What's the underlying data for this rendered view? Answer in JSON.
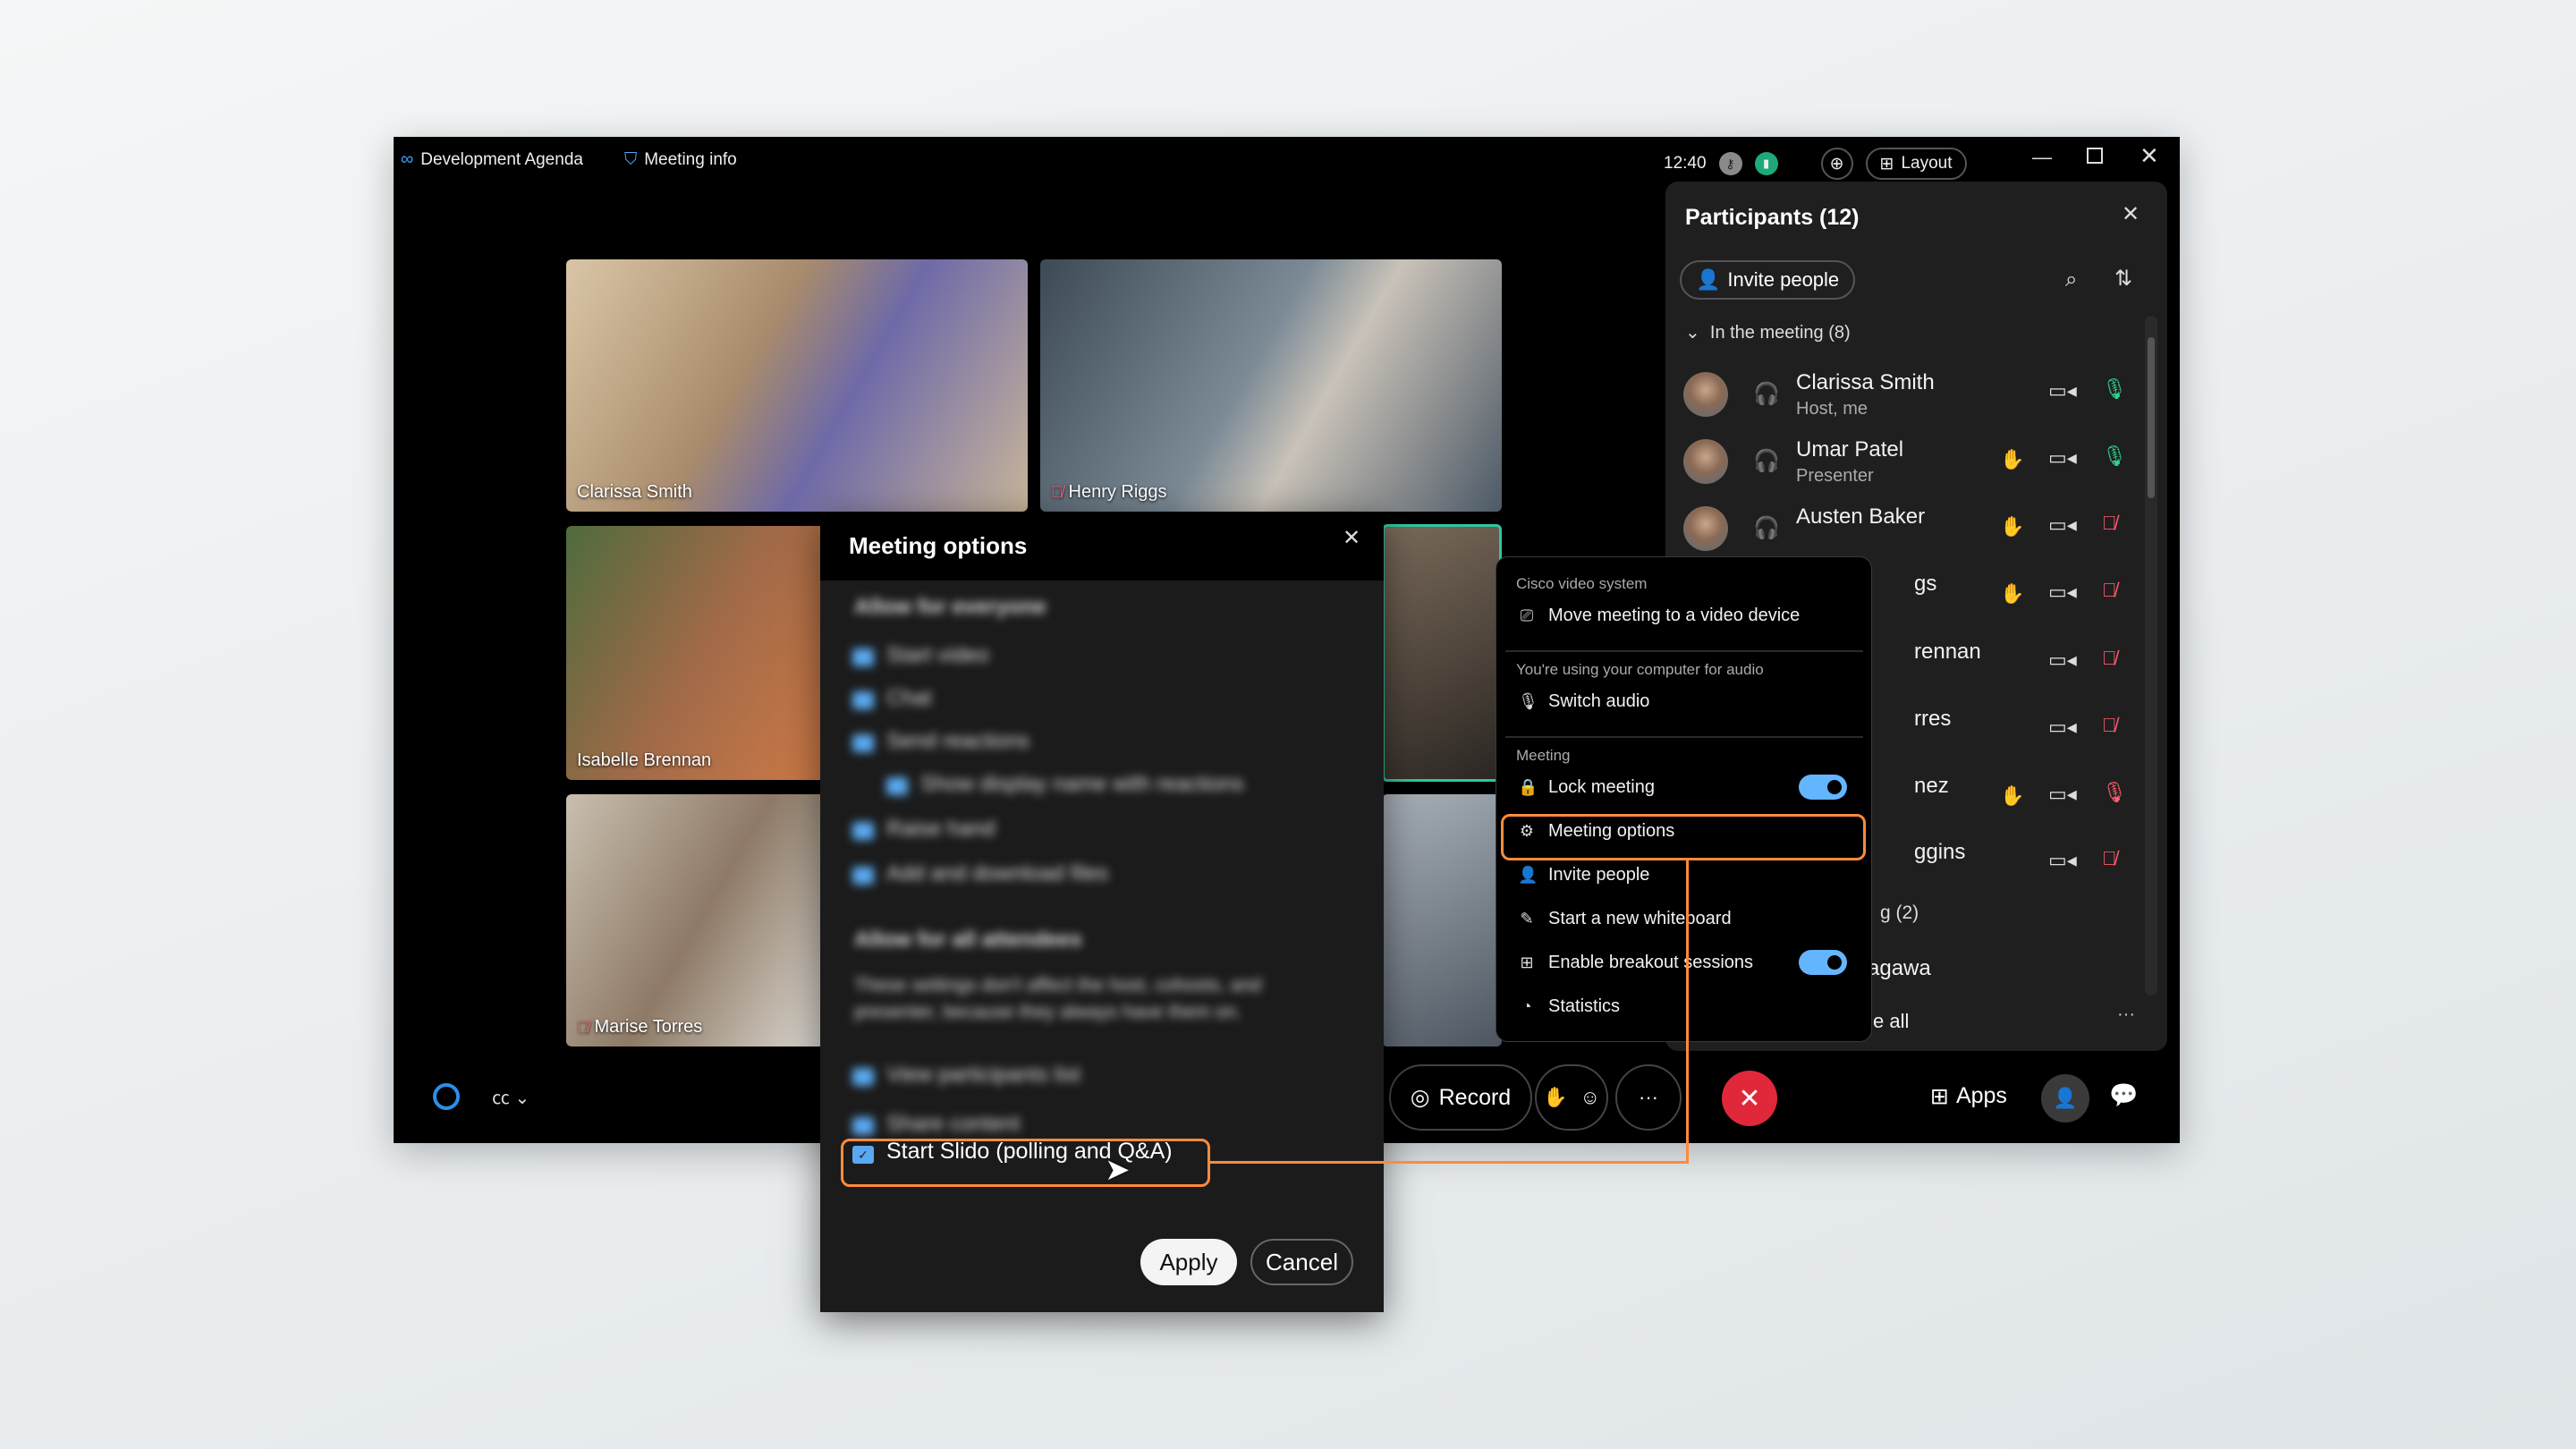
{
  "titlebar": {
    "meeting_title": "Development Agenda",
    "meeting_info": "Meeting info",
    "time": "12:40",
    "layout_label": "Layout"
  },
  "videos": [
    {
      "name": "Clarissa Smith",
      "muted": false
    },
    {
      "name": "Henry Riggs",
      "muted": true
    },
    {
      "name": "Isabelle Brennan",
      "muted": false
    },
    {
      "name": "Marise Torres",
      "muted": true
    }
  ],
  "participants": {
    "title": "Participants (12)",
    "invite_label": "Invite people",
    "section": "In the meeting (8)",
    "rows": [
      {
        "name": "Clarissa Smith",
        "role": "Host, me",
        "hand": false,
        "mic": "on"
      },
      {
        "name": "Umar Patel",
        "role": "Presenter",
        "hand": true,
        "mic": "on"
      },
      {
        "name": "Austen Baker",
        "role": "",
        "hand": true,
        "mic": "muted"
      },
      {
        "name": "gs",
        "hand": true,
        "mic": "muted"
      },
      {
        "name": "rennan",
        "hand": false,
        "mic": "muted"
      },
      {
        "name": "rres",
        "hand": false,
        "mic": "muted"
      },
      {
        "name": "nez",
        "hand": true,
        "mic": "active-red"
      },
      {
        "name": "ggins",
        "hand": false,
        "mic": "muted"
      }
    ],
    "section2": "g (2)",
    "row_after": "agawa",
    "footer": "e all"
  },
  "menu": {
    "h1": "Cisco video system",
    "move": "Move meeting to a video device",
    "h2": "You're using your computer for audio",
    "switch_audio": "Switch audio",
    "h3": "Meeting",
    "lock": "Lock meeting",
    "lock_on": true,
    "options": "Meeting options",
    "invite": "Invite people",
    "whiteboard": "Start a new whiteboard",
    "breakout": "Enable breakout sessions",
    "breakout_on": true,
    "statistics": "Statistics"
  },
  "dialog": {
    "title": "Meeting options",
    "section1": "Allow for everyone",
    "opts1": [
      "Start video",
      "Chat",
      "Send reactions",
      "Show display name with reactions",
      "Raise hand",
      "Add and download files"
    ],
    "section2": "Allow for all attendees",
    "note": "These settings don't affect the host, cohosts, and presenter, because they always have them on.",
    "opts2": [
      "View participants list",
      "Share content"
    ],
    "slido": "Start Slido (polling and Q&A)",
    "apply": "Apply",
    "cancel": "Cancel"
  },
  "toolbar": {
    "record": "Record",
    "apps": "Apps"
  },
  "colors": {
    "accent": "#64b5ff",
    "highlight": "#ff8a3d",
    "end_call": "#e0283a",
    "mic_on": "#2fd28f",
    "mic_muted": "#ff5c6c"
  }
}
